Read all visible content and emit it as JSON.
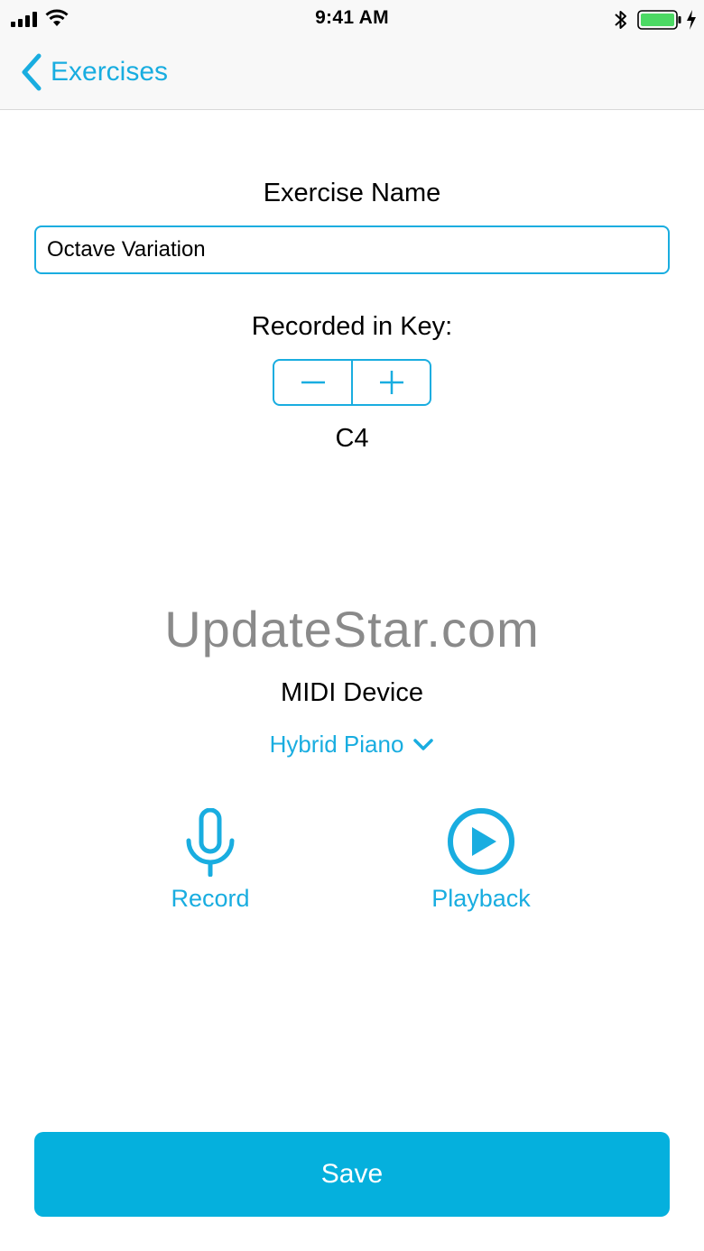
{
  "status_bar": {
    "time": "9:41 AM"
  },
  "nav": {
    "back_label": "Exercises"
  },
  "form": {
    "exercise_name_label": "Exercise Name",
    "exercise_name_value": "Octave Variation",
    "key_label": "Recorded in Key:",
    "key_value": "C4"
  },
  "watermark": "UpdateStar.com",
  "midi": {
    "label": "MIDI Device",
    "selected": "Hybrid Piano"
  },
  "actions": {
    "record_label": "Record",
    "playback_label": "Playback"
  },
  "save_label": "Save",
  "icons": {
    "back": "chevron-left-icon",
    "minus": "minus-icon",
    "plus": "plus-icon",
    "dropdown": "chevron-down-icon",
    "record": "microphone-icon",
    "playback": "play-circle-icon",
    "signal": "cellular-signal-icon",
    "wifi": "wifi-icon",
    "bluetooth": "bluetooth-icon",
    "battery": "battery-icon",
    "charging": "charging-bolt-icon"
  },
  "colors": {
    "accent": "#19ade0",
    "save_button": "#05b0dd",
    "battery_fill": "#4cd964"
  }
}
